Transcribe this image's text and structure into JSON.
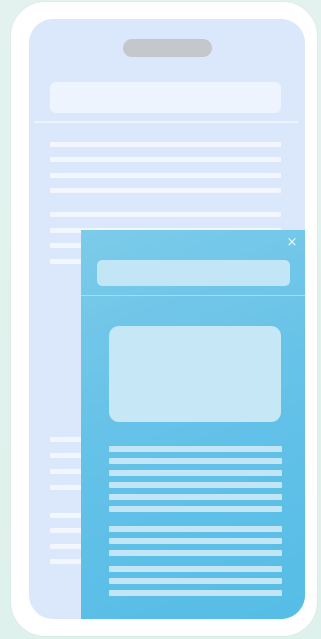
{
  "drawer": {
    "close_glyph": "×",
    "close_icon": "close-icon"
  },
  "colors": {
    "page_background": "#e3f2ee",
    "phone_frame": "#ffffff",
    "screen_background": "#dbe7fa",
    "notch": "#c4c7cc",
    "skeleton_light": "#f2f7ff",
    "drawer_gradient_start": "#7ccbe9",
    "drawer_gradient_end": "#55bde6",
    "drawer_skeleton": "#c3e6f6"
  }
}
